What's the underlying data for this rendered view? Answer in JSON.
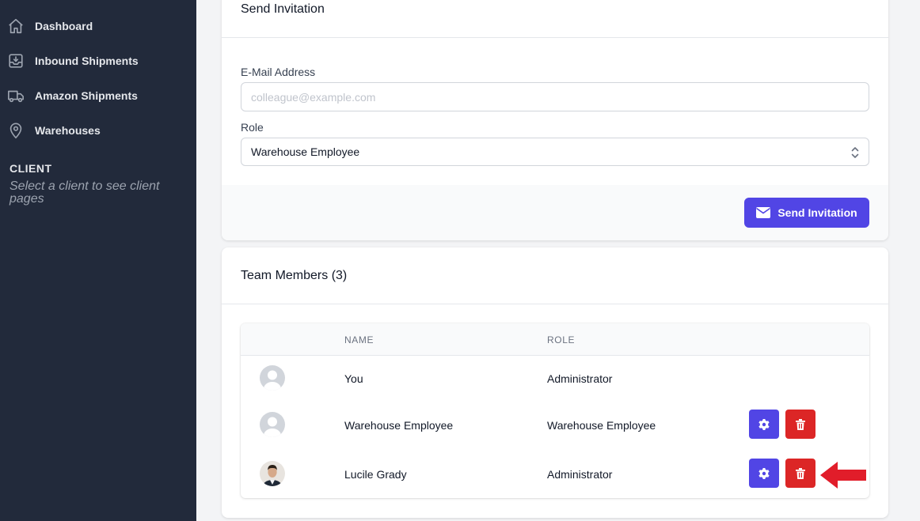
{
  "sidebar": {
    "items": [
      {
        "label": "Dashboard",
        "icon": "home-icon"
      },
      {
        "label": "Inbound Shipments",
        "icon": "inbox-download-icon"
      },
      {
        "label": "Amazon Shipments",
        "icon": "truck-icon"
      },
      {
        "label": "Warehouses",
        "icon": "location-pin-icon"
      }
    ],
    "client_heading": "CLIENT",
    "client_hint": "Select a client to see client pages"
  },
  "invite": {
    "title": "Send Invitation",
    "email_label": "E-Mail Address",
    "email_value": "",
    "email_placeholder": "colleague@example.com",
    "role_label": "Role",
    "role_selected": "Warehouse Employee",
    "send_button": "Send Invitation"
  },
  "team": {
    "title": "Team Members (3)",
    "columns": {
      "avatar": "",
      "name": "NAME",
      "role": "ROLE"
    },
    "members": [
      {
        "name": "You",
        "role": "Administrator",
        "avatar": "default-avatar"
      },
      {
        "name": "Warehouse Employee",
        "role": "Warehouse Employee",
        "avatar": "default-avatar"
      },
      {
        "name": "Lucile Grady",
        "role": "Administrator",
        "avatar": "photo-avatar"
      }
    ]
  },
  "colors": {
    "sidebar_bg": "#222a3b",
    "primary": "#5145e5",
    "danger": "#dc2626",
    "annotation_arrow": "#e11d2a"
  }
}
